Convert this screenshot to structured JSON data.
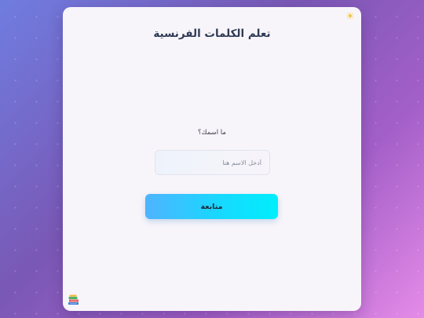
{
  "app": {
    "title": "تعلم الكلمات الفرنسية"
  },
  "icons": {
    "theme_toggle": "sun-icon",
    "corner": "books-icon"
  },
  "form": {
    "question": "ما اسمك؟",
    "name_placeholder": "أدخل الاسم هنا",
    "name_value": "",
    "continue_label": "متابعة"
  },
  "colors": {
    "accent_start": "#4fb3ff",
    "accent_end": "#00eefc",
    "title": "#2f3a55",
    "card": "#f8f5fa"
  }
}
